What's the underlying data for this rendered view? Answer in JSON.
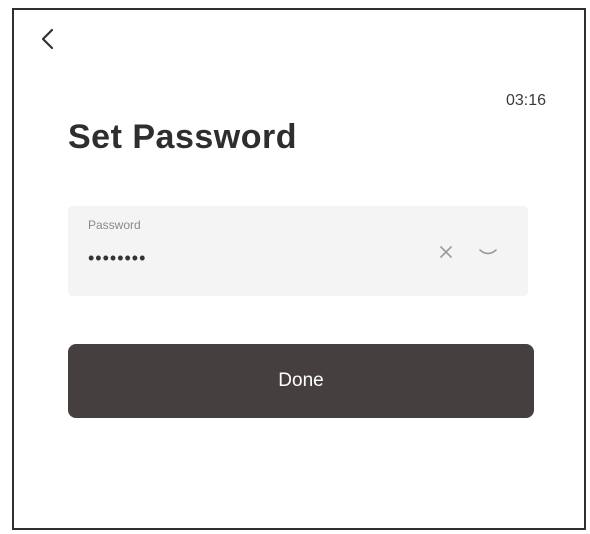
{
  "header": {
    "back_icon": "chevron-left-icon",
    "timer": "03:16"
  },
  "page": {
    "title": "Set Password"
  },
  "password_field": {
    "label": "Password",
    "value": "••••••••",
    "clear_icon": "close-icon",
    "visibility_icon": "eye-closed-icon"
  },
  "actions": {
    "done_label": "Done"
  },
  "colors": {
    "button_bg": "#453f3f",
    "field_bg": "#f4f4f4",
    "text": "#2e2e2e"
  }
}
